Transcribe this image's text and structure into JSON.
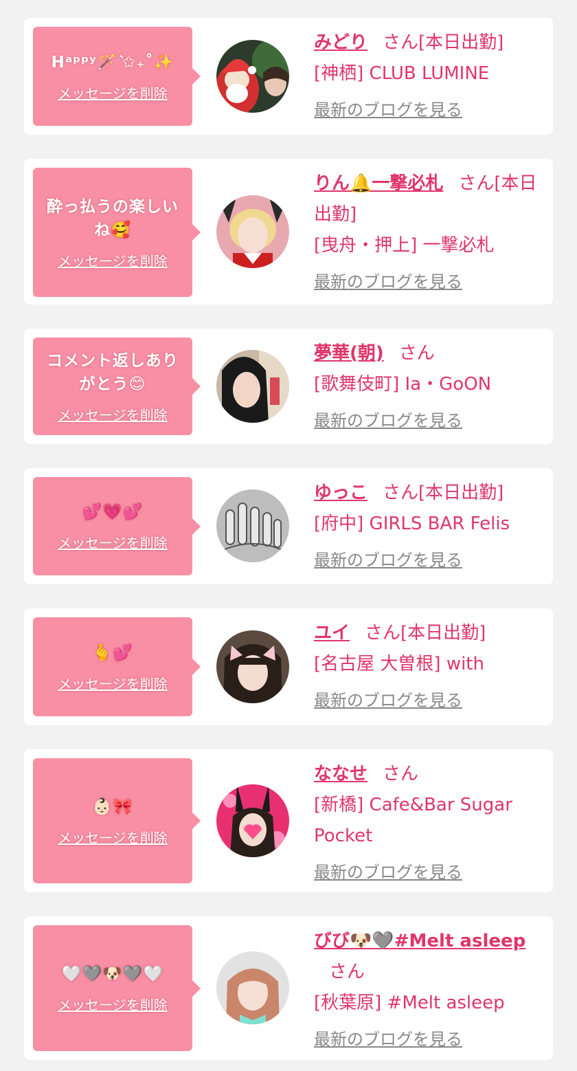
{
  "delete_label": "メッセージを削除",
  "blog_label": "最新のブログを見る",
  "cards": [
    {
      "message": "Hᵃᵖᵖʸ🪄 ͛✩₊˚✨",
      "name": "みどり",
      "status": "さん[本日出勤]",
      "shop": "[神栖] CLUB LUMINE"
    },
    {
      "message": "酔っ払うの楽しいね🥰",
      "name": "りん🔔一撃必札",
      "status": "さん[本日出勤]",
      "shop": "[曳舟・押上] 一撃必札"
    },
    {
      "message": "コメント返しありがとう😊",
      "name": "夢華(朝)",
      "status": "さん",
      "shop": "[歌舞伎町] Ia・GoON"
    },
    {
      "message": "💕💗💕",
      "name": "ゆっこ",
      "status": "さん[本日出勤]",
      "shop": "[府中] GIRLS BAR Felis"
    },
    {
      "message": "🫰💕",
      "name": "ユイ",
      "status": "さん[本日出勤]",
      "shop": "[名古屋 大曽根] with"
    },
    {
      "message": "👶🏻🎀",
      "name": "ななせ",
      "status": "さん",
      "shop": "[新橋] Cafe&Bar Sugar Pocket"
    },
    {
      "message": "🤍🩶🐶🩶🤍",
      "name": "びび🐶🩶#Melt asleep",
      "status": "さん",
      "shop": "[秋葉原] #Melt asleep"
    }
  ],
  "colors": {
    "background": "#f2f2f2",
    "bubble": "#f98fa4",
    "accent": "#e0356a",
    "blog_link": "#888888"
  }
}
